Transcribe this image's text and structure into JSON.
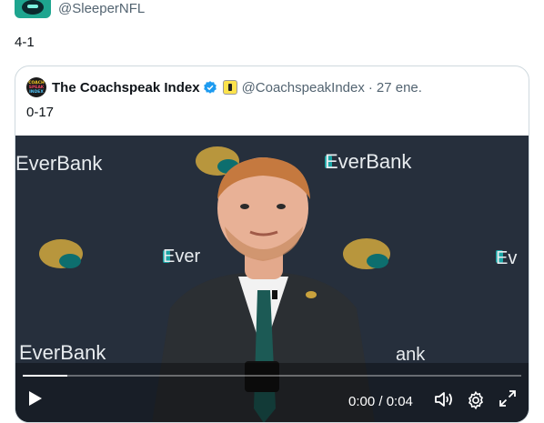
{
  "top": {
    "handle": "@SleeperNFL"
  },
  "tweet": {
    "text": "4-1"
  },
  "quote": {
    "avatar_text": [
      "COACH",
      "SPEAK",
      "INDEX"
    ],
    "name": "The Coachspeak Index",
    "handle": "@CoachspeakIndex",
    "separator": "·",
    "date": "27 ene.",
    "text": "0-17",
    "video": {
      "brand_texts": [
        "EverBank",
        "EverBank",
        "Ever",
        "EverBank",
        "Ev",
        "ank"
      ],
      "time": "0:00 / 0:04",
      "progress": 0.09
    }
  },
  "colors": {
    "verified": "#1d9bf0",
    "secondary_text": "#536471",
    "border": "#cfd9de"
  },
  "icons": [
    "play-icon",
    "volume-icon",
    "settings-icon",
    "fullscreen-icon",
    "verified-icon",
    "affiliate-badge-icon"
  ]
}
